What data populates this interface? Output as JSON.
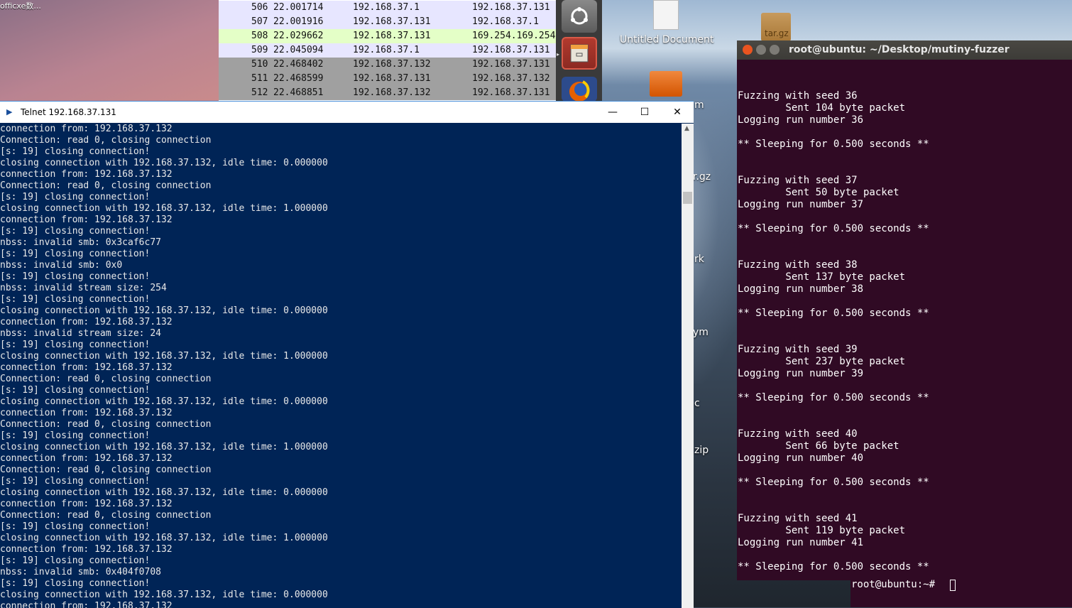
{
  "desktop": {
    "corner_label": "officxe数...",
    "untitled_document": "Untitled Document",
    "tar_label": "tar.gz",
    "clipped_labels": [
      "m",
      "r.gz",
      "rk",
      "ym",
      "c",
      "zip"
    ]
  },
  "packet_list": {
    "rows": [
      {
        "no": "506",
        "time": "22.001714",
        "src": "192.168.37.1",
        "dst": "192.168.37.131",
        "color": "#e7e6ff"
      },
      {
        "no": "507",
        "time": "22.001916",
        "src": "192.168.37.131",
        "dst": "192.168.37.1",
        "color": "#e7e6ff"
      },
      {
        "no": "508",
        "time": "22.029662",
        "src": "192.168.37.131",
        "dst": "169.254.169.254",
        "color": "#e4ffc7"
      },
      {
        "no": "509",
        "time": "22.045094",
        "src": "192.168.37.1",
        "dst": "192.168.37.131",
        "color": "#e7e6ff"
      },
      {
        "no": "510",
        "time": "22.468402",
        "src": "192.168.37.132",
        "dst": "192.168.37.131",
        "color": "#a0a0a0"
      },
      {
        "no": "511",
        "time": "22.468599",
        "src": "192.168.37.131",
        "dst": "192.168.37.132",
        "color": "#a0a0a0"
      },
      {
        "no": "512",
        "time": "22.468851",
        "src": "192.168.37.132",
        "dst": "192.168.37.131",
        "color": "#a0a0a0"
      }
    ]
  },
  "telnet": {
    "title": "Telnet 192.168.37.131",
    "minimize": "—",
    "maximize": "☐",
    "close": "✕",
    "lines": [
      "connection from: 192.168.37.132",
      "Connection: read 0, closing connection",
      "[s: 19] closing connection!",
      "closing connection with 192.168.37.132, idle time: 0.000000",
      "connection from: 192.168.37.132",
      "Connection: read 0, closing connection",
      "[s: 19] closing connection!",
      "closing connection with 192.168.37.132, idle time: 1.000000",
      "connection from: 192.168.37.132",
      "[s: 19] closing connection!",
      "nbss: invalid smb: 0x3caf6c77",
      "[s: 19] closing connection!",
      "nbss: invalid smb: 0x0",
      "[s: 19] closing connection!",
      "nbss: invalid stream size: 254",
      "[s: 19] closing connection!",
      "closing connection with 192.168.37.132, idle time: 0.000000",
      "connection from: 192.168.37.132",
      "nbss: invalid stream size: 24",
      "[s: 19] closing connection!",
      "closing connection with 192.168.37.132, idle time: 1.000000",
      "connection from: 192.168.37.132",
      "Connection: read 0, closing connection",
      "[s: 19] closing connection!",
      "closing connection with 192.168.37.132, idle time: 0.000000",
      "connection from: 192.168.37.132",
      "Connection: read 0, closing connection",
      "[s: 19] closing connection!",
      "closing connection with 192.168.37.132, idle time: 1.000000",
      "connection from: 192.168.37.132",
      "Connection: read 0, closing connection",
      "[s: 19] closing connection!",
      "closing connection with 192.168.37.132, idle time: 0.000000",
      "connection from: 192.168.37.132",
      "Connection: read 0, closing connection",
      "[s: 19] closing connection!",
      "closing connection with 192.168.37.132, idle time: 1.000000",
      "connection from: 192.168.37.132",
      "[s: 19] closing connection!",
      "nbss: invalid smb: 0x404f0708",
      "[s: 19] closing connection!",
      "closing connection with 192.168.37.132, idle time: 0.000000",
      "connection from: 192.168.37.132"
    ]
  },
  "terminal": {
    "title": "root@ubuntu: ~/Desktop/mutiny-fuzzer",
    "lines": [
      "",
      "Fuzzing with seed 36",
      "        Sent 104 byte packet",
      "Logging run number 36",
      "",
      "** Sleeping for 0.500 seconds **",
      "",
      "",
      "Fuzzing with seed 37",
      "        Sent 50 byte packet",
      "Logging run number 37",
      "",
      "** Sleeping for 0.500 seconds **",
      "",
      "",
      "Fuzzing with seed 38",
      "        Sent 137 byte packet",
      "Logging run number 38",
      "",
      "** Sleeping for 0.500 seconds **",
      "",
      "",
      "Fuzzing with seed 39",
      "        Sent 237 byte packet",
      "Logging run number 39",
      "",
      "** Sleeping for 0.500 seconds **",
      "",
      "",
      "Fuzzing with seed 40",
      "        Sent 66 byte packet",
      "Logging run number 40",
      "",
      "** Sleeping for 0.500 seconds **",
      "",
      "",
      "Fuzzing with seed 41",
      "        Sent 119 byte packet",
      "Logging run number 41",
      "",
      "** Sleeping for 0.500 seconds **"
    ],
    "prompt": "root@ubuntu:~#"
  }
}
